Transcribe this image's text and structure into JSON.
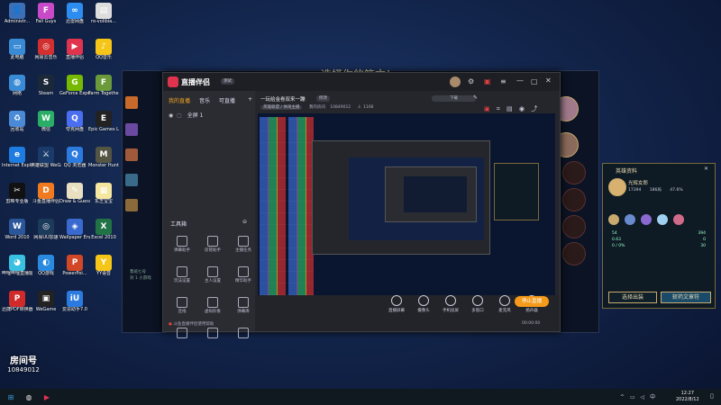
{
  "desktop": {
    "icons": [
      {
        "label": "Administr...",
        "color": "#3b6fb6",
        "glyph": "👤"
      },
      {
        "label": "Fall Guys",
        "color": "#c94ac8",
        "glyph": "F"
      },
      {
        "label": "迅雷网盘",
        "color": "#2d8cf0",
        "glyph": "∞"
      },
      {
        "label": "ro-volibia...",
        "color": "#ddd",
        "glyph": "▤"
      },
      {
        "label": "此电脑",
        "color": "#3a8bd6",
        "glyph": "▭"
      },
      {
        "label": "网易云音乐",
        "color": "#d23030",
        "glyph": "◎"
      },
      {
        "label": "直播伴侣",
        "color": "#e0334d",
        "glyph": "▶"
      },
      {
        "label": "QQ音乐",
        "color": "#f5c518",
        "glyph": "♪"
      },
      {
        "label": "网络",
        "color": "#3a8bd6",
        "glyph": "◍"
      },
      {
        "label": "Steam",
        "color": "#1b2838",
        "glyph": "S"
      },
      {
        "label": "GeForce Experience",
        "color": "#76b900",
        "glyph": "G"
      },
      {
        "label": "Farm Together",
        "color": "#6a9a3a",
        "glyph": "F"
      },
      {
        "label": "回收站",
        "color": "#4a8ad6",
        "glyph": "♻"
      },
      {
        "label": "微信",
        "color": "#2aae67",
        "glyph": "W"
      },
      {
        "label": "夸克网盘",
        "color": "#4a6ef0",
        "glyph": "Q"
      },
      {
        "label": "Epic Games Launcher",
        "color": "#222",
        "glyph": "E"
      },
      {
        "label": "Internet Explorer",
        "color": "#1e7be0",
        "glyph": "e"
      },
      {
        "label": "英雄联盟 WeGame版",
        "color": "#1a3a6a",
        "glyph": "⚔"
      },
      {
        "label": "QQ 浏览器",
        "color": "#2a7ae0",
        "glyph": "Q"
      },
      {
        "label": "Monster Hunter...",
        "color": "#554",
        "glyph": "M"
      },
      {
        "label": "剪映专业版",
        "color": "#111",
        "glyph": "✂"
      },
      {
        "label": "斗鱼直播伴侣",
        "color": "#f07a20",
        "glyph": "D"
      },
      {
        "label": "Draw & Guess",
        "color": "#e8e0c0",
        "glyph": "✎"
      },
      {
        "label": "东芝宝宝",
        "color": "#f5e6a0",
        "glyph": "▦"
      },
      {
        "label": "Word 2010",
        "color": "#2b579a",
        "glyph": "W"
      },
      {
        "label": "网易UU加速",
        "color": "#1c3a5a",
        "glyph": "◎"
      },
      {
        "label": "Wallpaper Engine: ...",
        "color": "#3a6ad0",
        "glyph": "◈"
      },
      {
        "label": "Excel 2010",
        "color": "#217346",
        "glyph": "X"
      },
      {
        "label": "哔哩哔哩直播姬",
        "color": "#3ac0e0",
        "glyph": "◕"
      },
      {
        "label": "QQ游戏",
        "color": "#2a8ae0",
        "glyph": "◐"
      },
      {
        "label": "PowerPoi...",
        "color": "#d24726",
        "glyph": "P"
      },
      {
        "label": "YY语音",
        "color": "#f5c518",
        "glyph": "Y"
      },
      {
        "label": "迅捷PDF转换器",
        "color": "#d02a2a",
        "glyph": "P"
      },
      {
        "label": "WeGame",
        "color": "#222",
        "glyph": "▣"
      },
      {
        "label": "爱思助手7.0",
        "color": "#2a7ae0",
        "glyph": "iU"
      }
    ],
    "watermark": {
      "line1": "房间号",
      "line2": "10849012"
    }
  },
  "game_window": {
    "banner": "选择你的符文！",
    "side_chat": [
      "鲁班七号",
      "对 1 小游戏"
    ]
  },
  "app": {
    "logo": "直播伴侣",
    "version_badge": "测试",
    "left_tabs": [
      "我的直播",
      "音乐",
      "可直播"
    ],
    "scene_label": "全屏 1",
    "tools_title": "工具箱",
    "tools": [
      {
        "label": "弹幕助手"
      },
      {
        "label": "房管助手"
      },
      {
        "label": "主播任务"
      },
      {
        "label": "玩法设置"
      },
      {
        "label": "主人设置"
      },
      {
        "label": "精华助手"
      },
      {
        "label": "连线"
      },
      {
        "label": "虚拟形象"
      },
      {
        "label": "弹幕库"
      },
      {
        "label": ""
      },
      {
        "label": ""
      },
      {
        "label": ""
      }
    ],
    "stream_title": "一玩给金卷双来一蹦",
    "pill_edit": "修改",
    "pill_download": "下载",
    "stats": {
      "category": "英雄联盟 / 休闲主播",
      "room": "我的房间",
      "room_id": "10849012",
      "viewers": "1166"
    },
    "bottom_buttons": [
      {
        "label": "直播屏幕"
      },
      {
        "label": "摄像头"
      },
      {
        "label": "手机投屏"
      },
      {
        "label": "多窗口"
      },
      {
        "label": "麦克风"
      },
      {
        "label": "扬声器"
      }
    ],
    "start_button": "停止直播",
    "footer_status": "斗鱼直播伴侣使用帮助",
    "timer": "00:00:00"
  },
  "hero_panel": {
    "title": "英雄资料",
    "hero_name": "光辉女郎",
    "stats_line": [
      "17394",
      "186局",
      "47.6%"
    ],
    "stat_rows": [
      "54",
      "0.63",
      "0 / 0%",
      "394",
      "0",
      "30"
    ],
    "btn_left": "选择出装",
    "btn_right": "斩药文章符"
  },
  "taskbar": {
    "time": "12:27",
    "date": "2022/8/12",
    "apps": [
      {
        "glyph": "⊞",
        "color": "#3a9ae0"
      },
      {
        "glyph": "◍",
        "color": "#e8e8e8"
      },
      {
        "glyph": "▶",
        "color": "#e0334d"
      }
    ]
  }
}
